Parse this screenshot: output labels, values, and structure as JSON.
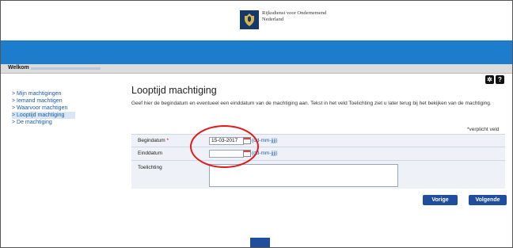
{
  "header": {
    "org_line1": "Rijksdienst voor Ondernemend",
    "org_line2": "Nederland"
  },
  "welkom": {
    "label": "Welkom"
  },
  "sidebar": {
    "items": [
      {
        "label": "> Mijn machtigingen"
      },
      {
        "label": "> Iemand machtigen"
      },
      {
        "label": "> Waarvoor machtigen"
      },
      {
        "label": "> Looptijd machtiging"
      },
      {
        "label": "> De machtiging"
      }
    ],
    "active_index": 3
  },
  "toolbar": {
    "settings_icon": "gear-icon",
    "help_icon": "help-icon",
    "help_glyph": "?"
  },
  "main": {
    "title": "Looptijd machtiging",
    "description": "Geef hier de begindatum en eventueel een einddatum van de machtiging aan. Tekst in het veld Toelichting ziet u later terug bij het bekijken van de machtiging.",
    "required_note": "*verplicht veld"
  },
  "form": {
    "begindatum": {
      "label": "Begindatum",
      "required_mark": "*",
      "value": "15-03-2017",
      "format": "(dd-mm-jjjj)"
    },
    "einddatum": {
      "label": "Einddatum",
      "value": "",
      "format": "(dd-mm-jjjj)"
    },
    "toelichting": {
      "label": "Toelichting",
      "value": ""
    }
  },
  "buttons": {
    "previous": "Vorige",
    "next": "Volgende"
  },
  "colors": {
    "brand_blue": "#1e7ccd",
    "button_blue": "#1f4e9c",
    "highlight_red": "#e01b1b"
  }
}
